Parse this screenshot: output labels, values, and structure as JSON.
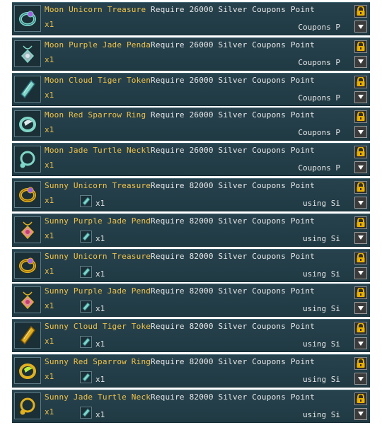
{
  "items": [
    {
      "name": "Moon Unicorn Treasure Ring",
      "tier": "moon",
      "shape": "ring",
      "requirement": "Require 26000 Silver Coupons Point",
      "quantity": "x1",
      "material_qty": "",
      "method": "Coupons P",
      "icon": "unicorn-ring-icon"
    },
    {
      "name": "Moon Purple Jade Pendant",
      "tier": "moon",
      "shape": "pendant",
      "requirement": "Require 26000 Silver Coupons Point",
      "quantity": "x1",
      "material_qty": "",
      "method": "Coupons P",
      "icon": "jade-pendant-icon"
    },
    {
      "name": "Moon Cloud Tiger Token",
      "tier": "moon",
      "shape": "token",
      "requirement": "Require 26000 Silver Coupons Point",
      "quantity": "x1",
      "material_qty": "",
      "method": "Coupons P",
      "icon": "tiger-token-icon"
    },
    {
      "name": "Moon Red Sparrow Ring",
      "tier": "moon",
      "shape": "sparrow",
      "requirement": "Require 26000 Silver Coupons Point",
      "quantity": "x1",
      "material_qty": "",
      "method": "Coupons P",
      "icon": "sparrow-ring-icon"
    },
    {
      "name": "Moon Jade Turtle Necklace",
      "tier": "moon",
      "shape": "necklace",
      "requirement": "Require 26000 Silver Coupons Point",
      "quantity": "x1",
      "material_qty": "",
      "method": "Coupons P",
      "icon": "turtle-necklace-icon"
    },
    {
      "name": "Sunny Unicorn Treasure Ring",
      "tier": "sunny",
      "shape": "ring",
      "requirement": "Require 82000 Silver Coupons Point",
      "quantity": "x1",
      "material_qty": "x1",
      "method": "using Si",
      "icon": "unicorn-ring-icon"
    },
    {
      "name": "Sunny Purple Jade Pendant",
      "tier": "sunny",
      "shape": "pendant",
      "requirement": "Require 82000 Silver Coupons Point",
      "quantity": "x1",
      "material_qty": "x1",
      "method": "using Si",
      "icon": "jade-pendant-icon"
    },
    {
      "name": "Sunny Unicorn Treasure Ring",
      "tier": "sunny",
      "shape": "ring",
      "requirement": "Require 82000 Silver Coupons Point",
      "quantity": "x1",
      "material_qty": "x1",
      "method": "using Si",
      "icon": "unicorn-ring-icon"
    },
    {
      "name": "Sunny Purple Jade Pendant",
      "tier": "sunny",
      "shape": "pendant",
      "requirement": "Require 82000 Silver Coupons Point",
      "quantity": "x1",
      "material_qty": "x1",
      "method": "using Si",
      "icon": "jade-pendant-icon"
    },
    {
      "name": "Sunny Cloud Tiger Token",
      "tier": "sunny",
      "shape": "token",
      "requirement": "Require 82000 Silver Coupons Point",
      "quantity": "x1",
      "material_qty": "x1",
      "method": "using Si",
      "icon": "tiger-token-icon"
    },
    {
      "name": "Sunny Red Sparrow Ring",
      "tier": "sunny",
      "shape": "sparrow",
      "requirement": "Require 82000 Silver Coupons Point",
      "quantity": "x1",
      "material_qty": "x1",
      "method": "using Si",
      "icon": "sparrow-ring-icon"
    },
    {
      "name": "Sunny Jade Turtle Necklace",
      "tier": "sunny",
      "shape": "necklace",
      "requirement": "Require 82000 Silver Coupons Point",
      "quantity": "x1",
      "material_qty": "x1",
      "method": "using Si",
      "icon": "turtle-necklace-icon"
    }
  ],
  "colors": {
    "row_bg": "#27424d",
    "name_gold": "#f0c24a",
    "moon_icon": "#7fd6c8",
    "sunny_icon": "#e0b020",
    "lock_gold": "#e8b000"
  }
}
